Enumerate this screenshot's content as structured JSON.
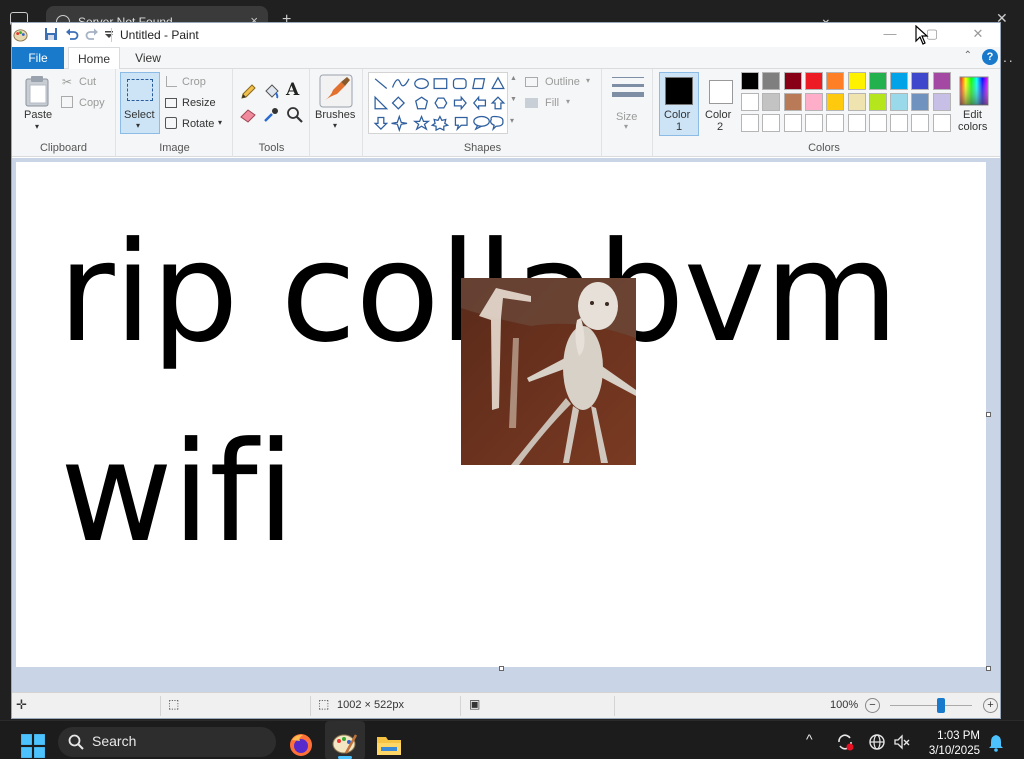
{
  "browser": {
    "tab_title": "Server Not Found",
    "tab_close": "×",
    "new_tab": "+",
    "more": "···"
  },
  "window": {
    "title": "Untitled - Paint",
    "minimize": "—",
    "maximize": "▢",
    "close": "✕"
  },
  "menu": {
    "file": "File",
    "home": "Home",
    "view": "View",
    "collapse": "⌃",
    "help": "?"
  },
  "ribbon": {
    "clipboard": {
      "label": "Clipboard",
      "paste": "Paste",
      "cut": "Cut",
      "copy": "Copy"
    },
    "image": {
      "label": "Image",
      "select": "Select",
      "crop": "Crop",
      "resize": "Resize",
      "rotate": "Rotate"
    },
    "tools": {
      "label": "Tools"
    },
    "brushes": {
      "label": "Brushes"
    },
    "shapes": {
      "label": "Shapes",
      "outline": "Outline",
      "fill": "Fill"
    },
    "size": {
      "label": "Size"
    },
    "colors": {
      "label": "Colors",
      "color1_line1": "Color",
      "color1_line2": "1",
      "color2_line1": "Color",
      "color2_line2": "2",
      "edit_line1": "Edit",
      "edit_line2": "colors",
      "color1_value": "#000000",
      "color2_value": "#ffffff",
      "palette_row1": [
        "#000000",
        "#7f7f7f",
        "#880015",
        "#ed1c24",
        "#ff7f27",
        "#fff200",
        "#22b14c",
        "#00a2e8",
        "#3f48cc",
        "#a349a4"
      ],
      "palette_row2": [
        "#ffffff",
        "#c3c3c3",
        "#b97a57",
        "#ffaec9",
        "#ffc90e",
        "#efe4b0",
        "#b5e61d",
        "#99d9ea",
        "#7092be",
        "#c8bfe7"
      ],
      "palette_row3": [
        "#ffffff",
        "#ffffff",
        "#ffffff",
        "#ffffff",
        "#ffffff",
        "#ffffff",
        "#ffffff",
        "#ffffff",
        "#ffffff",
        "#ffffff"
      ]
    }
  },
  "canvas": {
    "line1": "rip collabvm",
    "line2": "wifi"
  },
  "status": {
    "canvas_size": "1002 × 522px",
    "zoom": "100%",
    "zoom_level_percent": 100,
    "zoom_out": "−",
    "zoom_in": "+"
  },
  "taskbar": {
    "search": "Search",
    "time": "1:03 PM",
    "date": "3/10/2025",
    "tray_chevron": "^"
  }
}
